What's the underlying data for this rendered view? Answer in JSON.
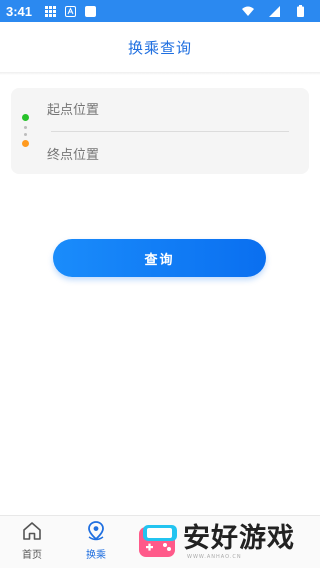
{
  "status_bar": {
    "time": "3:41"
  },
  "header": {
    "title": "换乘查询"
  },
  "route": {
    "start_placeholder": "起点位置",
    "end_placeholder": "终点位置"
  },
  "query_button": {
    "label": "查询"
  },
  "tabbar": {
    "items": [
      {
        "label": "首页",
        "icon": "home-icon",
        "active": false
      },
      {
        "label": "换乘",
        "icon": "location-pin-icon",
        "active": true
      }
    ]
  },
  "watermark": {
    "text": "安好游戏",
    "subtext": "WWW.ANHAO.CN"
  },
  "colors": {
    "accent": "#1f6fe0",
    "status_bar": "#2b89f0",
    "start_dot": "#27c22a",
    "end_dot": "#ff9a1f"
  }
}
